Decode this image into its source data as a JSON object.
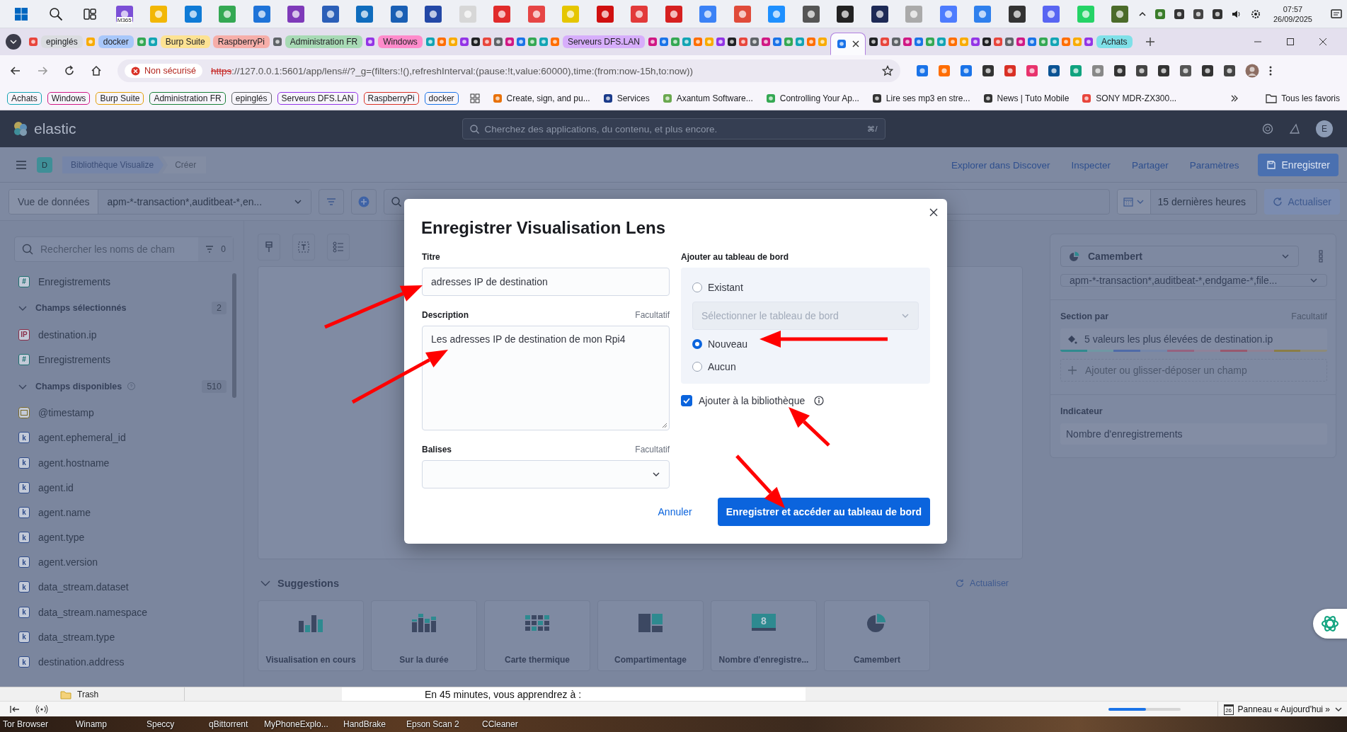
{
  "taskbar_top": {
    "icon_caption": "M365",
    "time": "07:57",
    "date": "26/09/2025"
  },
  "tab_strip": {
    "items": [
      {
        "kind": "favicons"
      },
      {
        "kind": "group",
        "label": "epinglés",
        "color": "#dadce0"
      },
      {
        "kind": "favicons"
      },
      {
        "kind": "group",
        "label": "docker",
        "color": "#a8c7fa"
      },
      {
        "kind": "favicons"
      },
      {
        "kind": "group",
        "label": "Burp Suite",
        "color": "#fde293"
      },
      {
        "kind": "group",
        "label": "RaspberryPi",
        "color": "#f6aea9"
      },
      {
        "kind": "favicons"
      },
      {
        "kind": "group",
        "label": "Administration FR",
        "color": "#a8dab5"
      },
      {
        "kind": "favicons"
      },
      {
        "kind": "group",
        "label": "Windows",
        "color": "#ff8bcb"
      },
      {
        "kind": "favicons"
      },
      {
        "kind": "group",
        "label": "Serveurs DFS.LAN",
        "color": "#d7aefb"
      },
      {
        "kind": "favicons"
      },
      {
        "kind": "tab",
        "selected": true
      },
      {
        "kind": "favicons"
      },
      {
        "kind": "group",
        "label": "Achats",
        "color": "#7fe0e8"
      }
    ]
  },
  "address_bar": {
    "security": "Non sécurisé",
    "url_scheme": "https",
    "url_rest": "://127.0.0.1:5601/app/lens#/?_g=(filters:!(),refreshInterval:(pause:!t,value:60000),time:(from:now-15h,to:now))"
  },
  "bookmark_bar": {
    "groups": [
      {
        "label": "Achats",
        "color": "#12a4b4"
      },
      {
        "label": "Windows",
        "color": "#d01884"
      },
      {
        "label": "Burp Suite",
        "color": "#e3a008"
      },
      {
        "label": "Administration FR",
        "color": "#188038"
      },
      {
        "label": "epinglés",
        "color": "#5f6368"
      },
      {
        "label": "Serveurs DFS.LAN",
        "color": "#9334e6"
      },
      {
        "label": "RaspberryPi",
        "color": "#d93025"
      },
      {
        "label": "docker",
        "color": "#1a73e8"
      }
    ],
    "links": [
      {
        "label": "Create, sign, and pu..."
      },
      {
        "label": "Services"
      },
      {
        "label": "Axantum Software..."
      },
      {
        "label": "Controlling Your Ap..."
      },
      {
        "label": "Lire ses mp3 en stre..."
      },
      {
        "label": "News | Tuto Mobile"
      },
      {
        "label": "SONY MDR-ZX300..."
      }
    ],
    "all_bookmarks": "Tous les favoris"
  },
  "kibana_header": {
    "logo": "elastic",
    "search_placeholder": "Cherchez des applications, du contenu, et plus encore.",
    "shortcut": "⌘/",
    "avatar": "E"
  },
  "kibana_nav": {
    "space": "D",
    "breadcrumbs": [
      "Bibliothèque Visualize",
      "Créer"
    ],
    "links": [
      "Explorer dans Discover",
      "Inspecter",
      "Partager",
      "Paramètres"
    ],
    "save_button": "Enregistrer"
  },
  "query_bar": {
    "data_view_label": "Vue de données",
    "data_view": "apm-*-transaction*,auditbeat-*,en...",
    "time_range": "15 dernières heures",
    "refresh": "Actualiser"
  },
  "field_sidebar": {
    "search_placeholder": "Rechercher les noms de cham",
    "filter_count": "0",
    "items": [
      {
        "kind": "field",
        "badge": "#",
        "color": "#1f6f70",
        "label": "Enregistrements"
      },
      {
        "kind": "section",
        "label": "Champs sélectionnés",
        "count": "2",
        "expanded": true,
        "help": false
      },
      {
        "kind": "field",
        "badge": "IP",
        "color": "#8a2f4a",
        "label": "destination.ip"
      },
      {
        "kind": "field",
        "badge": "#",
        "color": "#1f6f70",
        "label": "Enregistrements"
      },
      {
        "kind": "section",
        "label": "Champs disponibles",
        "count": "510",
        "expanded": true,
        "help": true
      },
      {
        "kind": "date_field",
        "color": "#7a6a2a",
        "label": "@timestamp"
      },
      {
        "kind": "field",
        "badge": "k",
        "color": "#2f4c8a",
        "label": "agent.ephemeral_id"
      },
      {
        "kind": "field",
        "badge": "k",
        "color": "#2f4c8a",
        "label": "agent.hostname"
      },
      {
        "kind": "field",
        "badge": "k",
        "color": "#2f4c8a",
        "label": "agent.id"
      },
      {
        "kind": "field",
        "badge": "k",
        "color": "#2f4c8a",
        "label": "agent.name"
      },
      {
        "kind": "field",
        "badge": "k",
        "color": "#2f4c8a",
        "label": "agent.type"
      },
      {
        "kind": "field",
        "badge": "k",
        "color": "#2f4c8a",
        "label": "agent.version"
      },
      {
        "kind": "field",
        "badge": "k",
        "color": "#2f4c8a",
        "label": "data_stream.dataset"
      },
      {
        "kind": "field",
        "badge": "k",
        "color": "#2f4c8a",
        "label": "data_stream.namespace"
      },
      {
        "kind": "field",
        "badge": "k",
        "color": "#2f4c8a",
        "label": "data_stream.type"
      },
      {
        "kind": "field",
        "badge": "k",
        "color": "#2f4c8a",
        "label": "destination.address"
      }
    ]
  },
  "workspace": {
    "suggestions_title": "Suggestions",
    "refresh": "Actualiser",
    "suggestions": [
      {
        "kind": "bar",
        "label": "Visualisation en cours"
      },
      {
        "kind": "bar_stacked",
        "label": "Sur la durée"
      },
      {
        "kind": "heatmap",
        "label": "Carte thermique"
      },
      {
        "kind": "treemap",
        "label": "Compartimentage"
      },
      {
        "kind": "metric",
        "label": "Nombre d'enregistre...",
        "value": "8"
      },
      {
        "kind": "pie",
        "label": "Camembert"
      }
    ]
  },
  "layer_panel": {
    "chart_type": "Camembert",
    "data_view": "apm-*-transaction*,auditbeat-*,endgame-*,file...",
    "slice_label": "Section par",
    "slice_optional": "Facultatif",
    "slice_value": "5 valeurs les plus élevées de destination.ip",
    "palette": [
      {
        "color": "#2f8a8e"
      },
      {
        "color": "#6f97a3"
      },
      {
        "color": "#4e6aa8"
      },
      {
        "color": "#7586a8"
      },
      {
        "color": "#96627f"
      },
      {
        "color": "#8f8299"
      },
      {
        "color": "#98586e"
      },
      {
        "color": "#8f8194"
      },
      {
        "color": "#8a7d45"
      },
      {
        "color": "#8c8a7a"
      }
    ],
    "add_field": "Ajouter ou glisser-déposer un champ",
    "metric_label": "Indicateur",
    "metric_value": "Nombre d'enregistrements"
  },
  "save_modal": {
    "title": "Enregistrer Visualisation Lens",
    "title_label": "Titre",
    "title_value": "adresses IP de destination",
    "description_label": "Description",
    "description_optional": "Facultatif",
    "description_value": "Les adresses IP de destination de mon Rpi4",
    "tags_label": "Balises",
    "tags_optional": "Facultatif",
    "dashboard_label": "Ajouter au tableau de bord",
    "options": [
      {
        "label": "Existant",
        "selected": false
      },
      {
        "label": "Nouveau",
        "selected": true
      },
      {
        "label": "Aucun",
        "selected": false
      }
    ],
    "dashboard_select": {
      "placeholder": "Sélectionner le tableau de bord",
      "disabled": true
    },
    "library": {
      "label": "Ajouter à la bibliothèque",
      "checked": true
    },
    "cancel": "Annuler",
    "confirm": "Enregistrer et accéder au tableau de bord"
  },
  "bottom_window": {
    "folder": "Trash",
    "doc_text": "En 45 minutes, vous apprendrez à :"
  },
  "status_bar": {
    "progress": {
      "level": 0.52
    },
    "calendar_day": "26",
    "panel_button": "Panneau « Aujourd'hui »"
  },
  "desktop_taskbar": {
    "labels": [
      "Tor Browser",
      "Winamp",
      "Speccy",
      "qBittorrent",
      "MyPhoneExplo...",
      "HandBrake",
      "Epson Scan 2",
      "CCleaner"
    ]
  }
}
